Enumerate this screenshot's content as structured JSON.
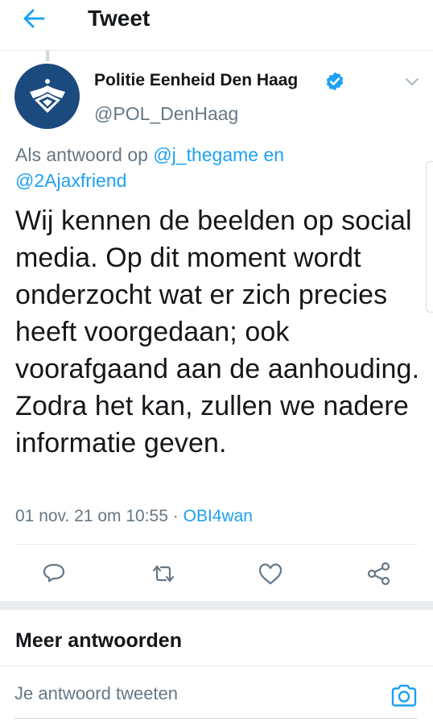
{
  "header": {
    "title": "Tweet"
  },
  "author": {
    "name": "Politie Eenheid Den Haag",
    "handle": "@POL_DenHaag"
  },
  "reply_to": {
    "prefix": "Als antwoord op",
    "mention1": "@j_thegame",
    "joiner": "en",
    "mention2": "@2Ajaxfriend"
  },
  "tweet": {
    "text": "Wij kennen de beelden op social media. Op dit moment wordt onderzocht wat er zich precies heeft voorgedaan; ook voorafgaand aan de aanhouding. Zodra het kan, zullen we nadere informatie geven.",
    "timestamp": "01 nov. 21 om 10:55",
    "separator": "·",
    "source": "OBI4wan"
  },
  "more_replies": {
    "title": "Meer antwoorden"
  },
  "reply_box": {
    "placeholder": "Je antwoord tweeten"
  },
  "icons": {
    "back": "arrow-left-icon",
    "verified": "verified-badge-icon",
    "menu": "chevron-down-icon",
    "reply": "reply-icon",
    "retweet": "retweet-icon",
    "like": "heart-icon",
    "share": "share-icon",
    "camera": "camera-icon"
  },
  "colors": {
    "accent": "#1da1f2",
    "secondary_text": "#657786",
    "avatar_bg": "#1b4a7f"
  }
}
